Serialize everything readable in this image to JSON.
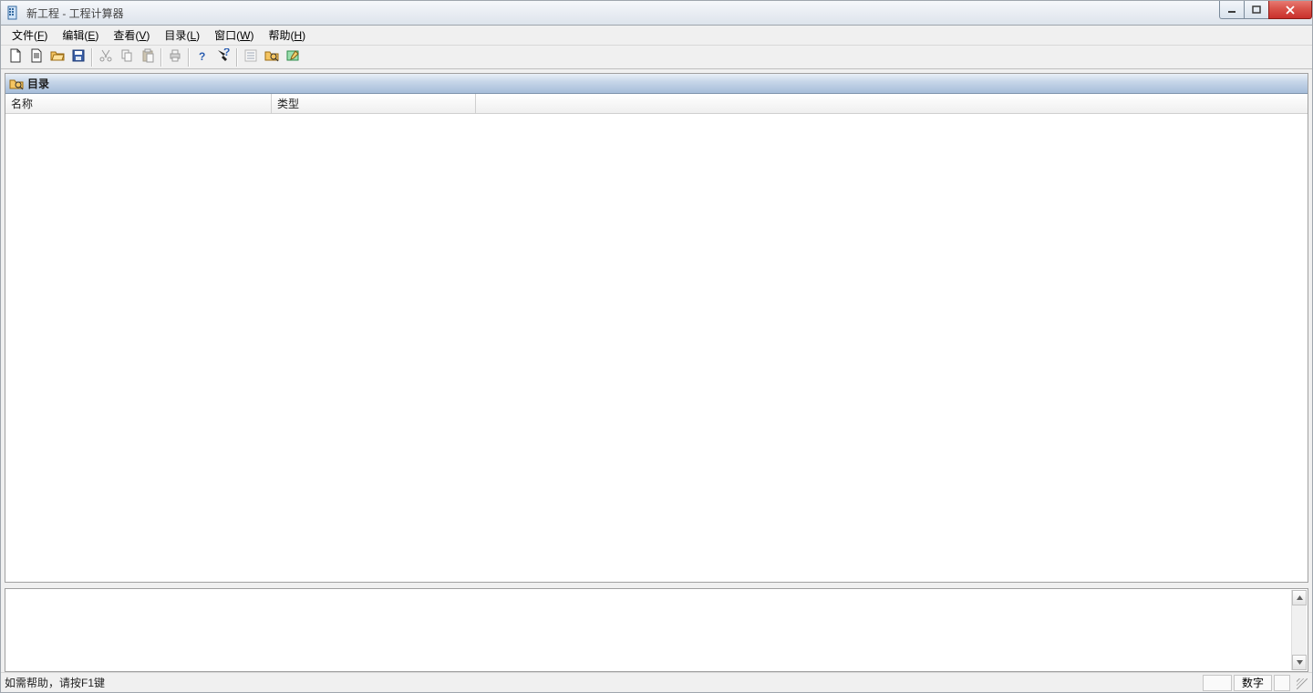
{
  "window": {
    "title": "新工程 - 工程计算器"
  },
  "menus": [
    {
      "label": "文件",
      "acc": "F"
    },
    {
      "label": "编辑",
      "acc": "E"
    },
    {
      "label": "查看",
      "acc": "V"
    },
    {
      "label": "目录",
      "acc": "L"
    },
    {
      "label": "窗口",
      "acc": "W"
    },
    {
      "label": "帮助",
      "acc": "H"
    }
  ],
  "toolbar": {
    "groups": [
      [
        "new",
        "new-page",
        "open",
        "save"
      ],
      [
        "cut",
        "copy",
        "paste"
      ],
      [
        "print"
      ],
      [
        "help",
        "context-help"
      ],
      [
        "list-view",
        "find",
        "note"
      ]
    ]
  },
  "directory_panel": {
    "title": "目录",
    "columns": [
      "名称",
      "类型",
      ""
    ]
  },
  "statusbar": {
    "help": "如需帮助，请按F1键",
    "numlock": "数字"
  }
}
